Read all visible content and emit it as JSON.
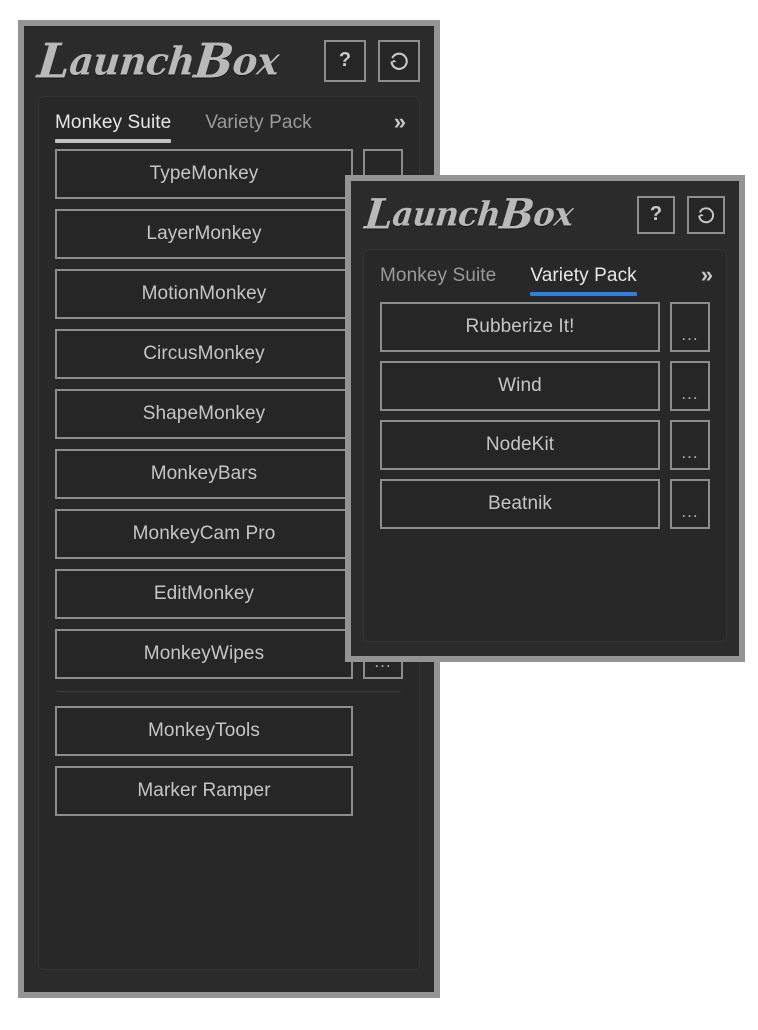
{
  "app": {
    "logo_text": "LaunchBox",
    "logo_lead": "L",
    "logo_rest": "aunch",
    "logo_mid": "B",
    "logo_tail": "ox"
  },
  "panels": [
    {
      "id": "monkey-suite-window",
      "header": {
        "help_label": "?",
        "help_icon": "question-mark-icon",
        "refresh_icon": "refresh-icon"
      },
      "tabs": {
        "items": [
          {
            "label": "Monkey Suite",
            "active": true,
            "underline": "gray"
          },
          {
            "label": "Variety Pack",
            "active": false,
            "underline": "none"
          }
        ],
        "more_label": "»",
        "more_icon": "double-chevron-right-icon"
      },
      "items": [
        {
          "label": "TypeMonkey",
          "options_label": "...",
          "has_options": true
        },
        {
          "label": "LayerMonkey",
          "options_label": "...",
          "has_options": true
        },
        {
          "label": "MotionMonkey",
          "options_label": "...",
          "has_options": true
        },
        {
          "label": "CircusMonkey",
          "options_label": "...",
          "has_options": true
        },
        {
          "label": "ShapeMonkey",
          "options_label": "...",
          "has_options": true
        },
        {
          "label": "MonkeyBars",
          "options_label": "...",
          "has_options": true
        },
        {
          "label": "MonkeyCam Pro",
          "options_label": "...",
          "has_options": true
        },
        {
          "label": "EditMonkey",
          "options_label": "...",
          "has_options": true
        },
        {
          "label": "MonkeyWipes",
          "options_label": "...",
          "has_options": true
        }
      ],
      "extra_items": [
        {
          "label": "MonkeyTools",
          "has_options": false
        },
        {
          "label": "Marker Ramper",
          "has_options": false
        }
      ]
    },
    {
      "id": "variety-pack-window",
      "header": {
        "help_label": "?",
        "help_icon": "question-mark-icon",
        "refresh_icon": "refresh-icon"
      },
      "tabs": {
        "items": [
          {
            "label": "Monkey Suite",
            "active": false,
            "underline": "none"
          },
          {
            "label": "Variety Pack",
            "active": true,
            "underline": "blue"
          }
        ],
        "more_label": "»",
        "more_icon": "double-chevron-right-icon"
      },
      "items": [
        {
          "label": "Rubberize It!",
          "options_label": "...",
          "has_options": true
        },
        {
          "label": "Wind",
          "options_label": "...",
          "has_options": true
        },
        {
          "label": "NodeKit",
          "options_label": "...",
          "has_options": true
        },
        {
          "label": "Beatnik",
          "options_label": "...",
          "has_options": true
        }
      ],
      "extra_items": []
    }
  ],
  "colors": {
    "window_border": "#949494",
    "window_bg": "#2b2b2b",
    "card_bg": "#282828",
    "button_bg": "#262626",
    "button_border": "#8c8c8c",
    "text": "#c5c5c5",
    "text_active": "#e6e6e6",
    "text_muted": "#9a9a9a",
    "accent_blue": "#2f7fe0",
    "accent_gray": "#c2c2c2"
  }
}
